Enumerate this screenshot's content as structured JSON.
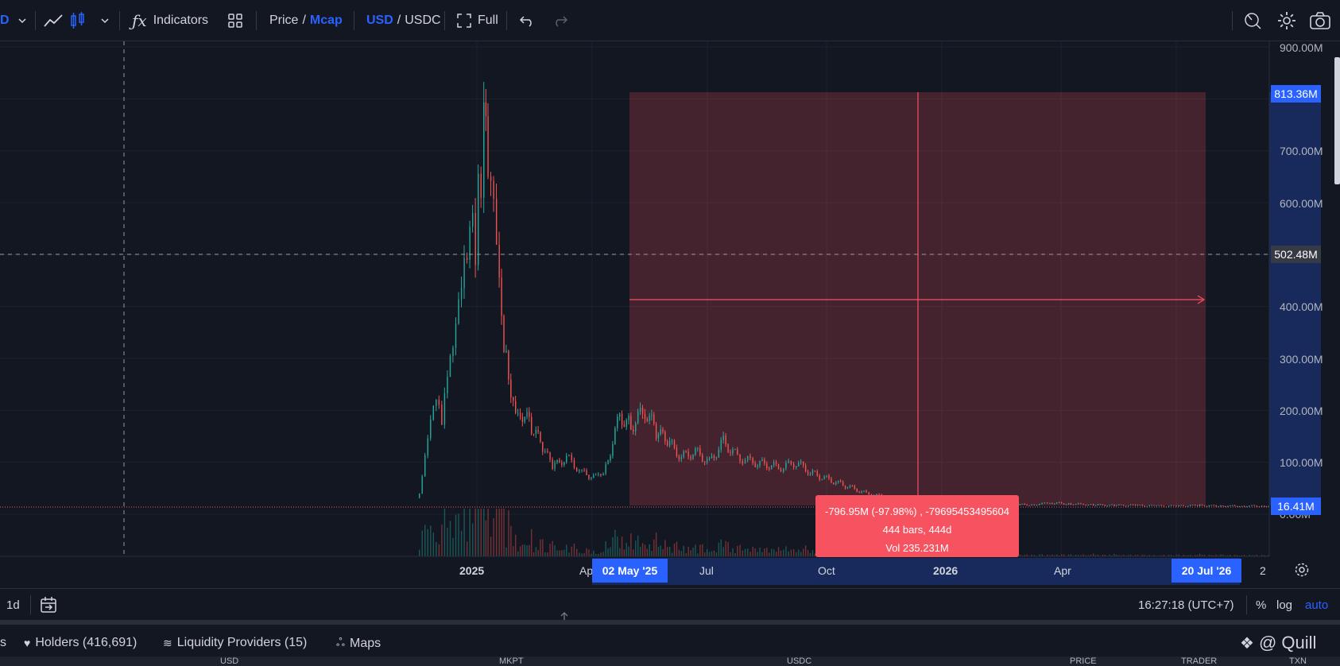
{
  "toolbar": {
    "symbol_fragment": "D",
    "indicators_label": "Indicators",
    "price_label": "Price",
    "slash": "/",
    "mcap_label": "Mcap",
    "usd_label": "USD",
    "usdc_label": "USDC",
    "full_label": "Full"
  },
  "price_axis": {
    "labels": [
      "900.00M",
      "700.00M",
      "600.00M",
      "400.00M",
      "300.00M",
      "200.00M",
      "100.00M",
      "0.00M"
    ],
    "top_marker": "813.36M",
    "crosshair_marker": "502.48M",
    "last_marker": "16.41M"
  },
  "time_axis": {
    "labels": [
      "2025",
      "Ap",
      "Jul",
      "Oct",
      "2026",
      "Apr",
      "2"
    ],
    "start_marker": "02 May '25",
    "end_marker": "20 Jul '26"
  },
  "measure": {
    "line1": "-796.95M (-97.98%) , -79695453495604",
    "line2": "444 bars, 444d",
    "line3": "Vol 235.231M"
  },
  "bottom": {
    "interval": "1d",
    "clock": "16:27:18 (UTC+7)",
    "percent": "%",
    "log": "log",
    "auto": "auto"
  },
  "tabs": {
    "partial": "s",
    "holders": "Holders (416,691)",
    "liquidity": "Liquidity Providers (15)",
    "maps": "Maps"
  },
  "watermark": "@ Quill",
  "columns": [
    "USD",
    "MKPT",
    "USDC",
    "PRICE",
    "TRADER",
    "TXN"
  ],
  "colors": {
    "background": "#131722",
    "up": "#26a69a",
    "down": "#ef5350",
    "accent": "#2962ff",
    "measure": "#f7525f"
  },
  "chart_data": {
    "type": "candlestick",
    "ylim": [
      0,
      900
    ],
    "unit": "M",
    "x": [
      "2024-12-10",
      "2024-12-14",
      "2024-12-18",
      "2024-12-22",
      "2024-12-26",
      "2024-12-30",
      "2025-01-03",
      "2025-01-07",
      "2025-01-11",
      "2025-01-15",
      "2025-01-17",
      "2025-01-19",
      "2025-01-21",
      "2025-01-23",
      "2025-01-25",
      "2025-01-28",
      "2025-02-01",
      "2025-02-05",
      "2025-02-10",
      "2025-02-15",
      "2025-02-20",
      "2025-02-28",
      "2025-03-08",
      "2025-03-15",
      "2025-03-25",
      "2025-04-05",
      "2025-04-15",
      "2025-04-22",
      "2025-05-02",
      "2025-05-10",
      "2025-05-20",
      "2025-05-28",
      "2025-06-05",
      "2025-06-15",
      "2025-06-25",
      "2025-07-05",
      "2025-07-15",
      "2025-07-25",
      "2025-08-05",
      "2025-08-15",
      "2025-08-25",
      "2025-09-05",
      "2025-09-15",
      "2025-09-25",
      "2025-10-05",
      "2025-10-15",
      "2025-10-25",
      "2025-11-05",
      "2025-11-15",
      "2025-11-25",
      "2025-12-05",
      "2025-12-15",
      "2025-12-25",
      "2026-01-05",
      "2026-01-20",
      "2026-02-05",
      "2026-02-20",
      "2026-03-05",
      "2026-03-20",
      "2026-04-05",
      "2026-04-20",
      "2026-05-05",
      "2026-05-20",
      "2026-06-05",
      "2026-06-20",
      "2026-07-05",
      "2026-07-20",
      "2026-08-05"
    ],
    "values": [
      40,
      120,
      200,
      240,
      180,
      260,
      300,
      380,
      460,
      540,
      600,
      520,
      720,
      650,
      800,
      620,
      560,
      420,
      300,
      220,
      200,
      170,
      130,
      90,
      110,
      80,
      70,
      90,
      190,
      170,
      200,
      160,
      140,
      110,
      120,
      100,
      140,
      110,
      100,
      95,
      90,
      100,
      80,
      70,
      60,
      50,
      40,
      35,
      30,
      25,
      22,
      21,
      20,
      20,
      19,
      19,
      18,
      22,
      20,
      18,
      17,
      17,
      16,
      16,
      17,
      16,
      16,
      16
    ],
    "measure_range": {
      "start": "02 May '25",
      "end": "20 Jul '26",
      "high": 813.36,
      "low": 16.41
    },
    "crosshair_value": 502.48,
    "last_value": 16.41
  }
}
